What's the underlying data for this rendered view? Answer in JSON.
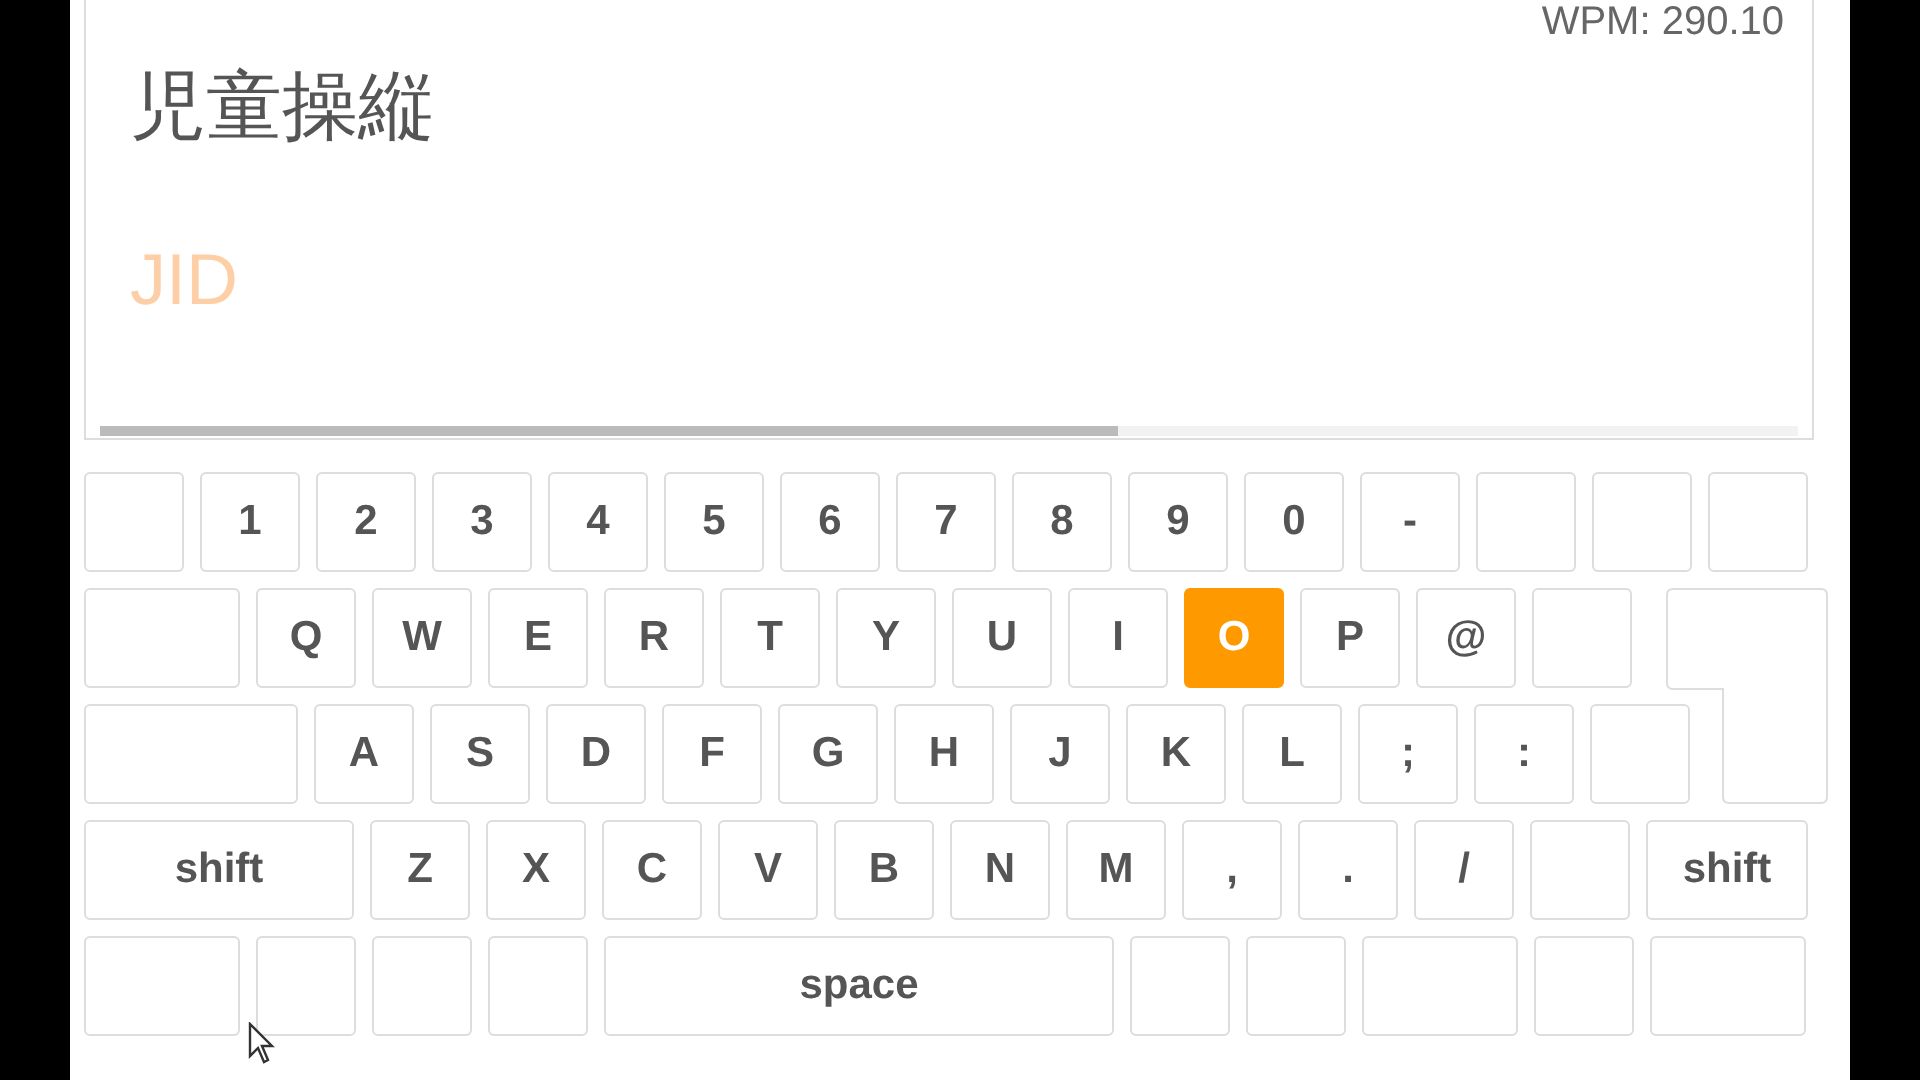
{
  "stats": {
    "wpm": "WPM: 290.10"
  },
  "prompt": {
    "text": "児童操縦",
    "typed": "JID"
  },
  "progress": {
    "level": 0.6
  },
  "keyboard": {
    "rows": [
      {
        "keys": [
          {
            "highlighted": false
          },
          {
            "label": "1",
            "highlighted": false
          },
          {
            "label": "2",
            "highlighted": false
          },
          {
            "label": "3",
            "highlighted": false
          },
          {
            "label": "4",
            "highlighted": false
          },
          {
            "label": "5",
            "highlighted": false
          },
          {
            "label": "6",
            "highlighted": false
          },
          {
            "label": "7",
            "highlighted": false
          },
          {
            "label": "8",
            "highlighted": false
          },
          {
            "label": "9",
            "highlighted": false
          },
          {
            "label": "0",
            "highlighted": false
          },
          {
            "label": "-",
            "highlighted": false
          },
          {
            "highlighted": false
          },
          {
            "highlighted": false
          },
          {
            "highlighted": false
          }
        ]
      },
      {
        "keys": [
          {
            "highlighted": false
          },
          {
            "label": "Q",
            "highlighted": false
          },
          {
            "label": "W",
            "highlighted": false
          },
          {
            "label": "E",
            "highlighted": false
          },
          {
            "label": "R",
            "highlighted": false
          },
          {
            "label": "T",
            "highlighted": false
          },
          {
            "label": "Y",
            "highlighted": false
          },
          {
            "label": "U",
            "highlighted": false
          },
          {
            "label": "I",
            "highlighted": false
          },
          {
            "label": "O",
            "highlighted": true
          },
          {
            "label": "P",
            "highlighted": false
          },
          {
            "label": "@",
            "highlighted": false
          },
          {
            "highlighted": false
          },
          {
            "highlighted": false
          }
        ]
      },
      {
        "keys": [
          {
            "highlighted": false
          },
          {
            "label": "A",
            "highlighted": false
          },
          {
            "label": "S",
            "highlighted": false
          },
          {
            "label": "D",
            "highlighted": false
          },
          {
            "label": "F",
            "highlighted": false
          },
          {
            "label": "G",
            "highlighted": false
          },
          {
            "label": "H",
            "highlighted": false
          },
          {
            "label": "J",
            "highlighted": false
          },
          {
            "label": "K",
            "highlighted": false
          },
          {
            "label": "L",
            "highlighted": false
          },
          {
            "label": ";",
            "highlighted": false
          },
          {
            "label": ":",
            "highlighted": false
          },
          {
            "highlighted": false
          }
        ]
      },
      {
        "keys": [
          {
            "label": "shift",
            "highlighted": false
          },
          {
            "label": "Z",
            "highlighted": false
          },
          {
            "label": "X",
            "highlighted": false
          },
          {
            "label": "C",
            "highlighted": false
          },
          {
            "label": "V",
            "highlighted": false
          },
          {
            "label": "B",
            "highlighted": false
          },
          {
            "label": "N",
            "highlighted": false
          },
          {
            "label": "M",
            "highlighted": false
          },
          {
            "label": ",",
            "highlighted": false
          },
          {
            "label": ".",
            "highlighted": false
          },
          {
            "label": "/",
            "highlighted": false
          },
          {
            "highlighted": false
          },
          {
            "label": "shift",
            "highlighted": false
          }
        ]
      },
      {
        "keys": [
          {
            "highlighted": false
          },
          {
            "highlighted": false
          },
          {
            "highlighted": false
          },
          {
            "highlighted": false
          },
          {
            "label": "space",
            "highlighted": false
          },
          {
            "highlighted": false
          },
          {
            "highlighted": false
          },
          {
            "highlighted": false
          },
          {
            "highlighted": false
          },
          {
            "highlighted": false
          }
        ]
      }
    ]
  }
}
